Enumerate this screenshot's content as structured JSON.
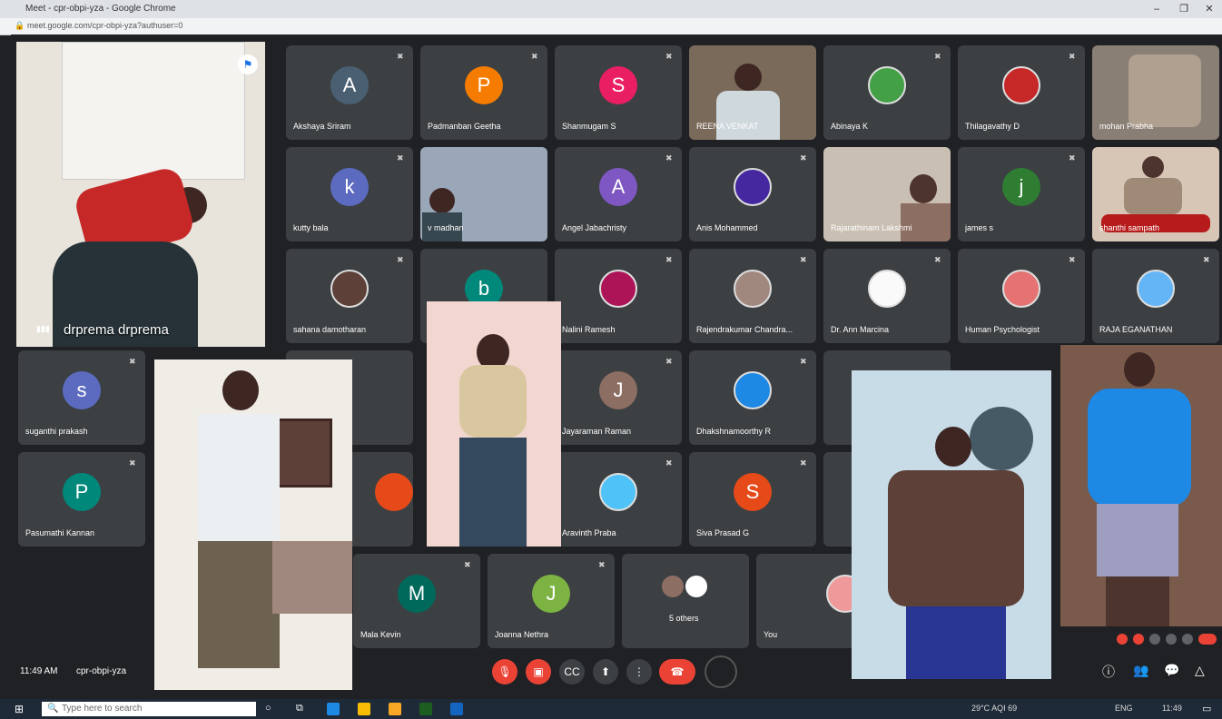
{
  "window": {
    "title": "Meet - cpr-obpi-yza - Google Chrome",
    "url": "meet.google.com/cpr-obpi-yza?authuser=0"
  },
  "tiles": [
    {
      "name": "Akshaya Sriram",
      "initial": "A",
      "color": "#4a6072"
    },
    {
      "name": "Padmanban Geetha",
      "initial": "P",
      "color": "#f57c00"
    },
    {
      "name": "Shanmugam S",
      "initial": "S",
      "color": "#e91e63"
    },
    {
      "name": "REENA VENKAT",
      "type": "video"
    },
    {
      "name": "Abinaya K",
      "type": "photo"
    },
    {
      "name": "Thilagavathy D",
      "type": "photo"
    },
    {
      "name": "mohan Prabha",
      "type": "video"
    },
    {
      "name": "kutty bala",
      "initial": "k",
      "color": "#5c6bc0"
    },
    {
      "name": "v madhan",
      "type": "video"
    },
    {
      "name": "Angel Jabachristy",
      "initial": "A",
      "color": "#7e57c2"
    },
    {
      "name": "Anis Mohammed",
      "type": "photo"
    },
    {
      "name": "Rajarathinam Lakshmi",
      "type": "video"
    },
    {
      "name": "james s",
      "initial": "j",
      "color": "#2e7d32"
    },
    {
      "name": "shanthi sampath",
      "type": "video"
    },
    {
      "name": "sahana damotharan",
      "type": "photo"
    },
    {
      "name": "Nalini Ramesh",
      "type": "photo"
    },
    {
      "name": "Rajendrakumar Chandra...",
      "type": "photo"
    },
    {
      "name": "Dr. Ann Marcina",
      "type": "photo"
    },
    {
      "name": "Human Psychologist",
      "type": "photo"
    },
    {
      "name": "RAJA EGANATHAN",
      "type": "photo"
    },
    {
      "name": "suganthi prakash",
      "initial": "s",
      "color": "#5c6bc0"
    },
    {
      "name": "Jayaraman Raman",
      "initial": "J",
      "color": "#8d6e63"
    },
    {
      "name": "Dhakshnamoorthy R",
      "type": "photo"
    },
    {
      "name": "Pasumathi Kannan",
      "initial": "P",
      "color": "#00897b"
    },
    {
      "name": "Aravinth Praba",
      "type": "photo"
    },
    {
      "name": "Siva Prasad G",
      "initial": "S",
      "color": "#e64a19"
    },
    {
      "name": "Mala Kevin",
      "initial": "M",
      "color": "#00695c"
    },
    {
      "name": "Joanna Nethra",
      "initial": "J",
      "color": "#7cb342"
    },
    {
      "name": "5 others",
      "type": "others"
    },
    {
      "name": "You",
      "type": "photo"
    }
  ],
  "pinned": {
    "name": "drprema drprema"
  },
  "meeting": {
    "time": "11:49 AM",
    "code": "cpr-obpi-yza"
  },
  "taskbar": {
    "search_placeholder": "Type here to search",
    "weather": "29°C AQI 69",
    "lang": "ENG",
    "time": "11:49"
  }
}
